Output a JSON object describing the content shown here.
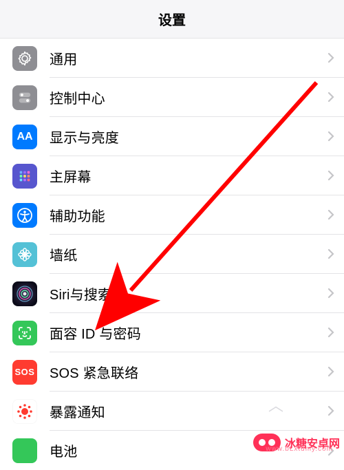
{
  "header": {
    "title": "设置"
  },
  "rows": [
    {
      "key": "general",
      "label": "通用",
      "icon": "gear-icon"
    },
    {
      "key": "control-center",
      "label": "控制中心",
      "icon": "toggles-icon"
    },
    {
      "key": "display",
      "label": "显示与亮度",
      "icon": "aa-icon"
    },
    {
      "key": "home-screen",
      "label": "主屏幕",
      "icon": "grid-icon"
    },
    {
      "key": "accessibility",
      "label": "辅助功能",
      "icon": "accessibility-icon"
    },
    {
      "key": "wallpaper",
      "label": "墙纸",
      "icon": "flower-icon"
    },
    {
      "key": "siri",
      "label": "Siri与搜索",
      "icon": "siri-icon"
    },
    {
      "key": "faceid",
      "label": "面容 ID 与密码",
      "icon": "faceid-icon"
    },
    {
      "key": "sos",
      "label": "SOS 紧急联络",
      "icon": "sos-icon"
    },
    {
      "key": "exposure",
      "label": "暴露通知",
      "icon": "exposure-icon"
    },
    {
      "key": "battery",
      "label": "电池",
      "icon": "battery-icon"
    }
  ],
  "watermark": {
    "brand": "冰糖安卓网",
    "url": "www.bLxtdmy.com"
  }
}
